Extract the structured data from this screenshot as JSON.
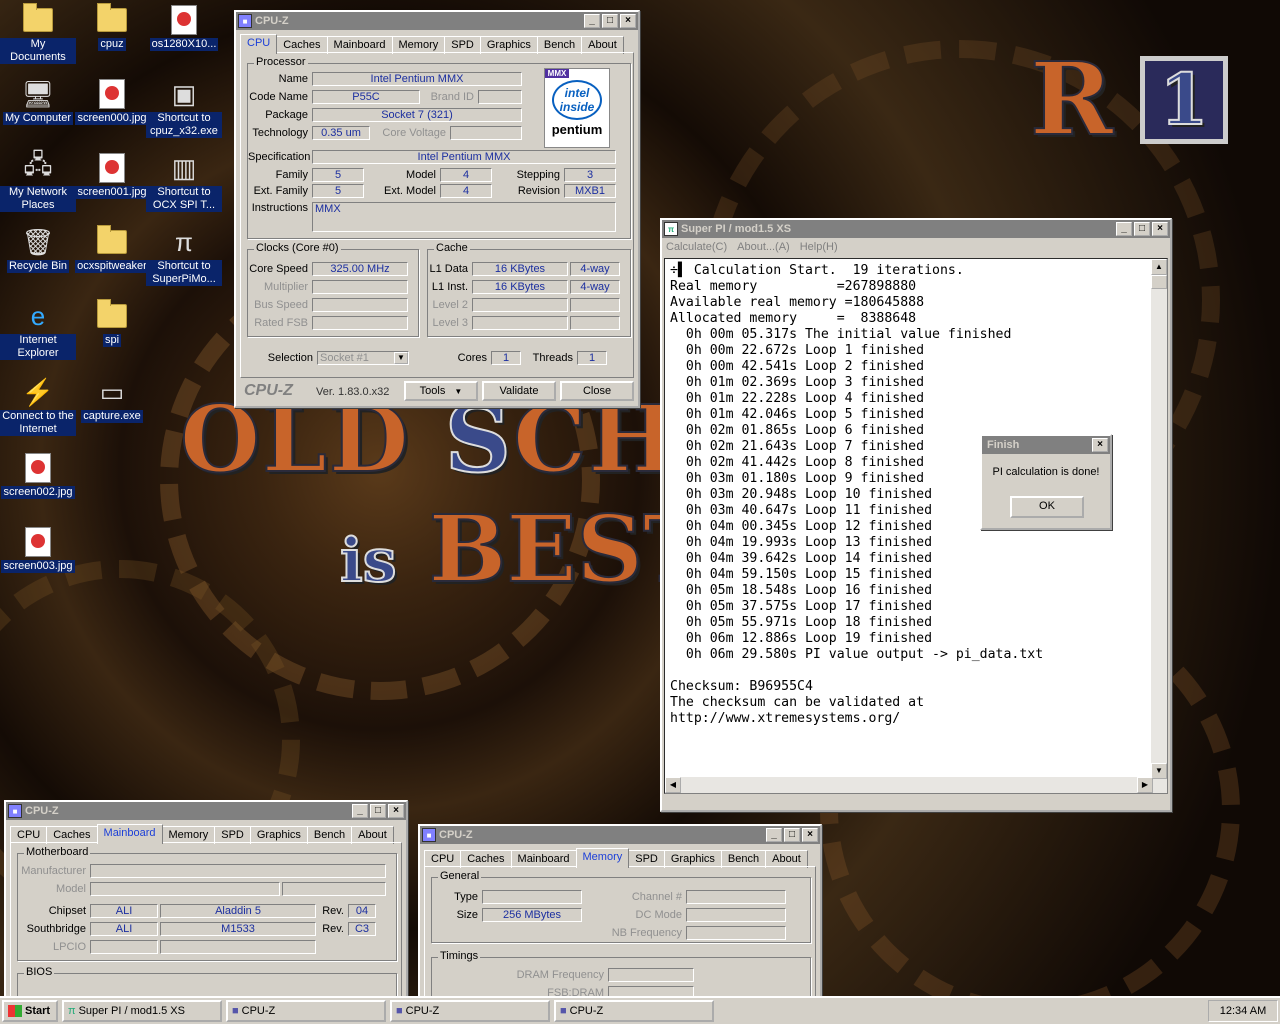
{
  "desktop": {
    "icons": [
      {
        "label": "My Documents",
        "icon": "my-documents-icon"
      },
      {
        "label": "cpuz",
        "icon": "folder-icon"
      },
      {
        "label": "os1280X10...",
        "icon": "jpg-file-icon"
      },
      {
        "label": "My Computer",
        "icon": "my-computer-icon"
      },
      {
        "label": "screen000.jpg",
        "icon": "jpg-file-icon"
      },
      {
        "label": "Shortcut to cpuz_x32.exe",
        "icon": "cpuz-shortcut-icon"
      },
      {
        "label": "My Network Places",
        "icon": "network-places-icon"
      },
      {
        "label": "screen001.jpg",
        "icon": "jpg-file-icon"
      },
      {
        "label": "Shortcut to OCX SPI T...",
        "icon": "ocx-shortcut-icon"
      },
      {
        "label": "Recycle Bin",
        "icon": "recycle-bin-icon"
      },
      {
        "label": "ocxspitweaker",
        "icon": "folder-icon"
      },
      {
        "label": "Shortcut to SuperPiMo...",
        "icon": "superpi-shortcut-icon"
      },
      {
        "label": "Internet Explorer",
        "icon": "internet-explorer-icon"
      },
      {
        "label": "spi",
        "icon": "folder-icon"
      },
      {
        "label": "Connect to the Internet",
        "icon": "connect-internet-icon"
      },
      {
        "label": "capture.exe",
        "icon": "exe-icon"
      },
      {
        "label": "screen002.jpg",
        "icon": "jpg-file-icon"
      },
      {
        "label": "screen003.jpg",
        "icon": "jpg-file-icon"
      }
    ]
  },
  "cpuz_main": {
    "title": "CPU-Z",
    "tabs": [
      "CPU",
      "Caches",
      "Mainboard",
      "Memory",
      "SPD",
      "Graphics",
      "Bench",
      "About"
    ],
    "processor": {
      "group": "Processor",
      "name_label": "Name",
      "name": "Intel Pentium MMX",
      "codename_label": "Code Name",
      "codename": "P55C",
      "brandid_label": "Brand ID",
      "package_label": "Package",
      "package": "Socket 7 (321)",
      "technology_label": "Technology",
      "technology": "0.35 um",
      "corevoltage_label": "Core Voltage",
      "spec_label": "Specification",
      "spec": "Intel Pentium MMX",
      "family_label": "Family",
      "family": "5",
      "model_label": "Model",
      "model": "4",
      "stepping_label": "Stepping",
      "stepping": "3",
      "extfamily_label": "Ext. Family",
      "extfamily": "5",
      "extmodel_label": "Ext. Model",
      "extmodel": "4",
      "revision_label": "Revision",
      "revision": "MXB1",
      "instructions_label": "Instructions",
      "instructions": "MMX"
    },
    "logo": {
      "top": "MMX",
      "mid": "intel inside",
      "brand": "pentium"
    },
    "clocks": {
      "group": "Clocks (Core #0)",
      "corespeed_label": "Core Speed",
      "corespeed": "325.00 MHz",
      "multiplier_label": "Multiplier",
      "busspeed_label": "Bus Speed",
      "ratedfsb_label": "Rated FSB"
    },
    "cache": {
      "group": "Cache",
      "l1data_label": "L1 Data",
      "l1data": "16 KBytes",
      "l1data_way": "4-way",
      "l1inst_label": "L1 Inst.",
      "l1inst": "16 KBytes",
      "l1inst_way": "4-way",
      "l2_label": "Level 2",
      "l3_label": "Level 3"
    },
    "selection_label": "Selection",
    "selection": "Socket #1",
    "cores_label": "Cores",
    "cores": "1",
    "threads_label": "Threads",
    "threads": "1",
    "footer": {
      "brand": "CPU-Z",
      "version": "Ver. 1.83.0.x32",
      "tools": "Tools",
      "validate": "Validate",
      "close": "Close"
    }
  },
  "superpi": {
    "title": "Super PI / mod1.5 XS",
    "menu": [
      "Calculate(C)",
      "About...(A)",
      "Help(H)"
    ],
    "lines": [
      "÷▌ Calculation Start.  19 iterations.",
      "Real memory          =267898880",
      "Available real memory =180645888",
      "Allocated memory     =  8388648",
      "  0h 00m 05.317s The initial value finished",
      "  0h 00m 22.672s Loop 1 finished",
      "  0h 00m 42.541s Loop 2 finished",
      "  0h 01m 02.369s Loop 3 finished",
      "  0h 01m 22.228s Loop 4 finished",
      "  0h 01m 42.046s Loop 5 finished",
      "  0h 02m 01.865s Loop 6 finished",
      "  0h 02m 21.643s Loop 7 finished",
      "  0h 02m 41.442s Loop 8 finished",
      "  0h 03m 01.180s Loop 9 finished",
      "  0h 03m 20.948s Loop 10 finished",
      "  0h 03m 40.647s Loop 11 finished",
      "  0h 04m 00.345s Loop 12 finished",
      "  0h 04m 19.993s Loop 13 finished",
      "  0h 04m 39.642s Loop 14 finished",
      "  0h 04m 59.150s Loop 15 finished",
      "  0h 05m 18.548s Loop 16 finished",
      "  0h 05m 37.575s Loop 17 finished",
      "  0h 05m 55.971s Loop 18 finished",
      "  0h 06m 12.886s Loop 19 finished",
      "  0h 06m 29.580s PI value output -> pi_data.txt",
      "",
      "Checksum: B96955C4",
      "The checksum can be validated at",
      "http://www.xtremesystems.org/"
    ]
  },
  "finish": {
    "title": "Finish",
    "message": "PI calculation is done!",
    "ok": "OK"
  },
  "cpuz_mb": {
    "title": "CPU-Z",
    "tabs": [
      "CPU",
      "Caches",
      "Mainboard",
      "Memory",
      "SPD",
      "Graphics",
      "Bench",
      "About"
    ],
    "group": "Motherboard",
    "manufacturer_label": "Manufacturer",
    "model_label": "Model",
    "chipset_label": "Chipset",
    "chipset_vendor": "ALI",
    "chipset": "Aladdin 5",
    "rev_label": "Rev.",
    "chipset_rev": "04",
    "south_label": "Southbridge",
    "south_vendor": "ALI",
    "south": "M1533",
    "south_rev": "C3",
    "lpcio_label": "LPCIO",
    "bios_group": "BIOS"
  },
  "cpuz_mem": {
    "title": "CPU-Z",
    "tabs": [
      "CPU",
      "Caches",
      "Mainboard",
      "Memory",
      "SPD",
      "Graphics",
      "Bench",
      "About"
    ],
    "group": "General",
    "type_label": "Type",
    "size_label": "Size",
    "size": "256 MBytes",
    "channel_label": "Channel #",
    "dcmode_label": "DC Mode",
    "nbfreq_label": "NB Frequency",
    "timings_group": "Timings",
    "dramfreq_label": "DRAM Frequency",
    "fsbdram_label": "FSB:DRAM"
  },
  "taskbar": {
    "start": "Start",
    "items": [
      "Super PI / mod1.5 XS",
      "CPU-Z",
      "CPU-Z",
      "CPU-Z"
    ],
    "clock": "12:34 AM"
  },
  "colors": {
    "titlebar_active": "#0a246a",
    "value_text": "#1c2fa0",
    "tab_selected": "#1c3fd8"
  }
}
